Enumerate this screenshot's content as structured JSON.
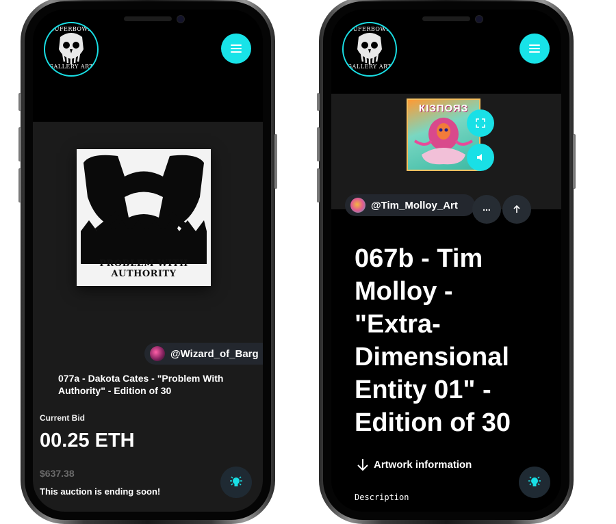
{
  "colors": {
    "accent": "#19e0e6",
    "panel": "#1b1b1b",
    "pill": "#23272e"
  },
  "brand": {
    "logo_top": "SUFERBOWF",
    "logo_bottom": "GALLERY ART"
  },
  "left_screen": {
    "artwork_caption": "PROBLEM WITH AUTHORITY",
    "creator_handle": "@Wizard_of_Barg",
    "title": "077a - Dakota Cates - \"Problem With Authority\" - Edition of 30",
    "current_bid_label": "Current Bid",
    "current_bid_value": "00.25 ETH",
    "usd_value": "$637.38",
    "auction_status": "This auction is ending soon!",
    "icons": [
      "menu-icon",
      "lightbulb-icon"
    ]
  },
  "right_screen": {
    "artwork_caption": "КІЗПОЯЗ",
    "creator_handle": "@Tim_Molloy_Art",
    "more_label": "...",
    "title": "067b - Tim Molloy - \"Extra-Dimensional Entity 01\" - Edition of 30",
    "artwork_info_label": "Artwork information",
    "description_label": "Description",
    "icons": [
      "menu-icon",
      "fullscreen-icon",
      "volume-icon",
      "arrow-up-icon",
      "arrow-down-icon",
      "lightbulb-icon"
    ]
  }
}
